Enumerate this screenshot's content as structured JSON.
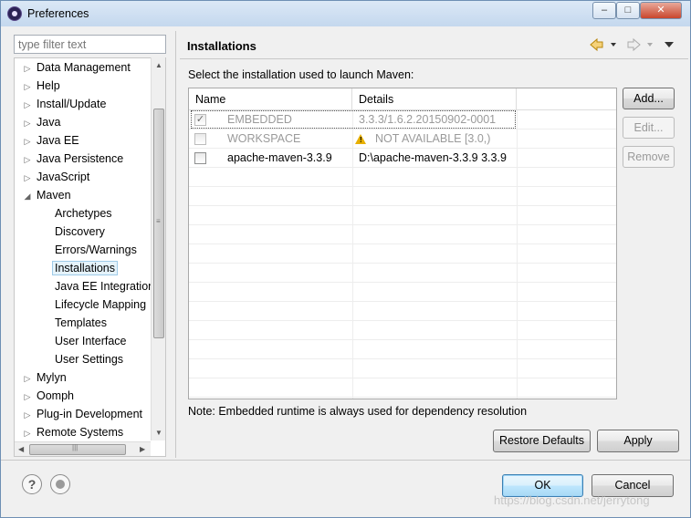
{
  "window": {
    "title": "Preferences"
  },
  "filter": {
    "placeholder": "type filter text"
  },
  "tree": {
    "items": [
      {
        "label": "Data Management"
      },
      {
        "label": "Help"
      },
      {
        "label": "Install/Update"
      },
      {
        "label": "Java"
      },
      {
        "label": "Java EE"
      },
      {
        "label": "Java Persistence"
      },
      {
        "label": "JavaScript"
      },
      {
        "label": "Maven"
      },
      {
        "label": "Archetypes"
      },
      {
        "label": "Discovery"
      },
      {
        "label": "Errors/Warnings"
      },
      {
        "label": "Installations"
      },
      {
        "label": "Java EE Integration"
      },
      {
        "label": "Lifecycle Mapping"
      },
      {
        "label": "Templates"
      },
      {
        "label": "User Interface"
      },
      {
        "label": "User Settings"
      },
      {
        "label": "Mylyn"
      },
      {
        "label": "Oomph"
      },
      {
        "label": "Plug-in Development"
      },
      {
        "label": "Remote Systems"
      }
    ],
    "selected": "Installations"
  },
  "page": {
    "title": "Installations",
    "instruction": "Select the installation used to launch Maven:",
    "note": "Note: Embedded runtime is always used for dependency resolution"
  },
  "table": {
    "columns": [
      "Name",
      "Details"
    ],
    "rows": [
      {
        "name": "EMBEDDED",
        "details": "3.3.3/1.6.2.20150902-0001",
        "checked": true,
        "enabled": false
      },
      {
        "name": "WORKSPACE",
        "details": "NOT AVAILABLE [3.0,)",
        "checked": false,
        "enabled": false,
        "warning": true
      },
      {
        "name": "apache-maven-3.3.9",
        "details": "D:\\apache-maven-3.3.9 3.3.9",
        "checked": false,
        "enabled": true
      }
    ]
  },
  "buttons": {
    "add": "Add...",
    "edit": "Edit...",
    "remove": "Remove",
    "restore_defaults": "Restore Defaults",
    "apply": "Apply",
    "ok": "OK",
    "cancel": "Cancel"
  },
  "watermark": "https://blog.csdn.net/jerrytong",
  "colors": {
    "accent": "#3c7fb1",
    "warning": "#e8b000",
    "selection": "#e5f3fb"
  }
}
